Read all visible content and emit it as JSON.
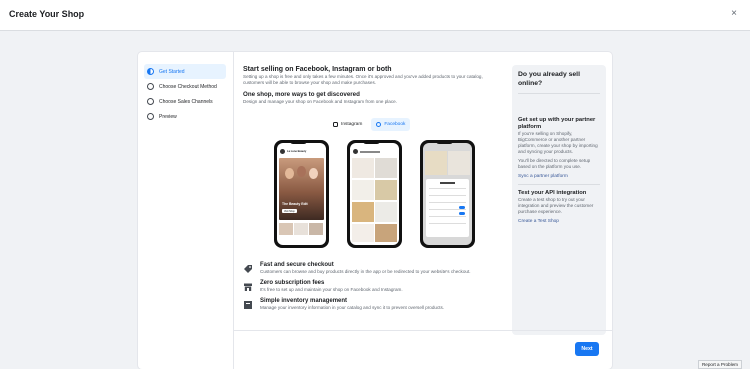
{
  "header": {
    "title": "Create Your Shop",
    "close_icon": "×"
  },
  "steps": [
    {
      "label": "Get Started",
      "active": true
    },
    {
      "label": "Choose Checkout Method",
      "active": false
    },
    {
      "label": "Choose Sales Channels",
      "active": false
    },
    {
      "label": "Preview",
      "active": false
    }
  ],
  "main": {
    "title": "Start selling on Facebook, Instagram or both",
    "intro": "Setting up a shop is free and only takes a few minutes. Once it's approved and you've added products to your catalog, customers will be able to browse your shop and make purchases.",
    "subtitle": "One shop, more ways to get discovered",
    "subtext": "Design and manage your shop on Facebook and Instagram from one place.",
    "toggle": {
      "instagram": "Instagram",
      "facebook": "Facebook",
      "selected": "Facebook"
    },
    "features": [
      {
        "icon": "tag-icon",
        "title": "Fast and secure checkout",
        "desc": "Customers can browse and buy products directly in the app or be redirected to your website's checkout."
      },
      {
        "icon": "storefront-icon",
        "title": "Zero subscription fees",
        "desc": "It's free to set up and maintain your shop on Facebook and Instagram."
      },
      {
        "icon": "inventory-icon",
        "title": "Simple inventory management",
        "desc": "Manage your inventory information in your catalog and sync it to prevent oversell products."
      }
    ]
  },
  "phone_preview": {
    "shop_name": "La Lune Beauty",
    "banner_title": "The Beauty Edit",
    "banner_button": "Visit Shop"
  },
  "sidebar": {
    "title": "Do you already sell online?",
    "partner_title": "Get set up with your partner platform",
    "partner_text": "If you're selling on Shopify, BigCommerce or another partner platform, create your shop by importing and syncing your products.",
    "partner_note": "You'll be directed to complete setup based on the platform you use.",
    "partner_link": "Sync a partner platform",
    "api_title": "Test your API integration",
    "api_text": "Create a test shop to try out your integration and preview the customer purchase experience.",
    "api_link": "Create a Test Shop"
  },
  "footer": {
    "next_label": "Next",
    "report_label": "Report a Problem"
  },
  "colors": {
    "accent": "#1877f2",
    "link": "#385898",
    "panel": "#f0f2f5"
  }
}
